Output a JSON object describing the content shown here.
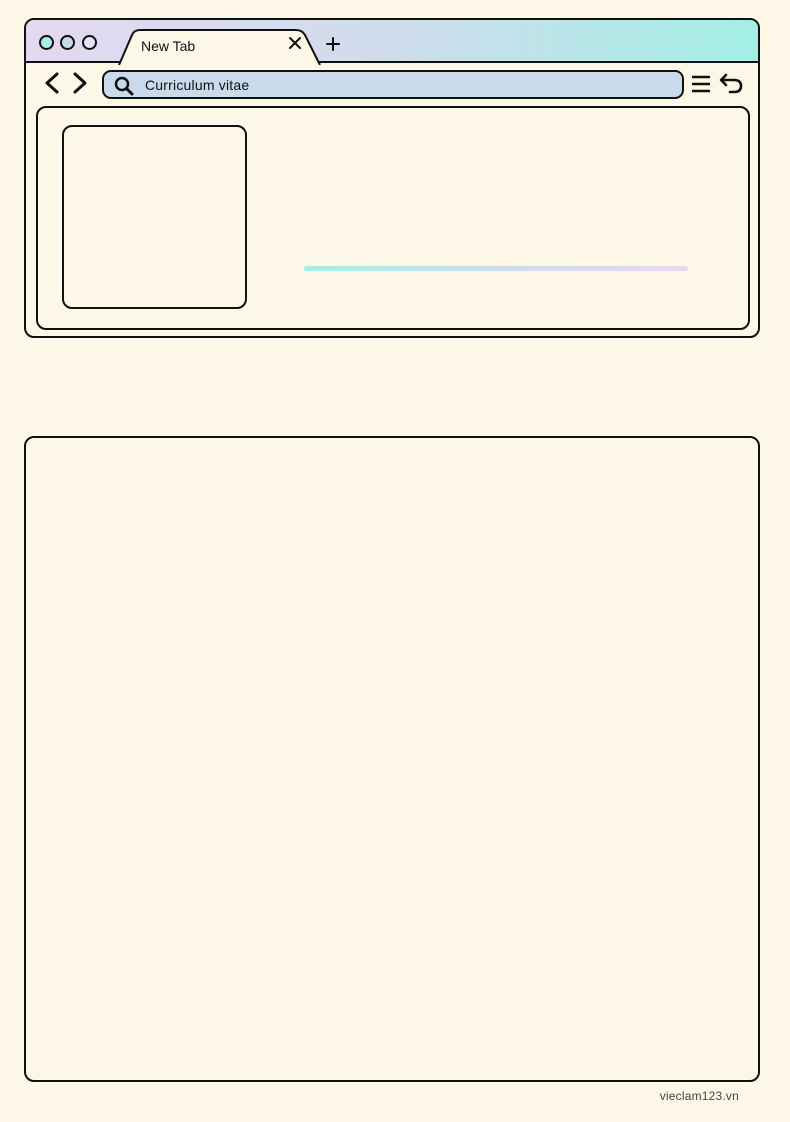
{
  "browser": {
    "window_controls": [
      "close-dot",
      "minimize-dot",
      "maximize-dot"
    ],
    "tab": {
      "label": "New Tab",
      "close_icon": "close-icon"
    },
    "new_tab_icon": "plus-icon",
    "nav": {
      "back_icon": "chevron-left-icon",
      "forward_icon": "chevron-right-icon"
    },
    "address_bar": {
      "icon": "search-icon",
      "value": "Curriculum vitae"
    },
    "menu_icon": "hamburger-menu-icon",
    "reload_icon": "reload-icon"
  },
  "colors": {
    "background": "#fdf7e8",
    "outline": "#111111",
    "mint": "#a4efe4",
    "lavender": "#e3d9f1",
    "address_bar": "#c9dbea"
  },
  "footer": {
    "brand": "vieclam123.vn"
  }
}
